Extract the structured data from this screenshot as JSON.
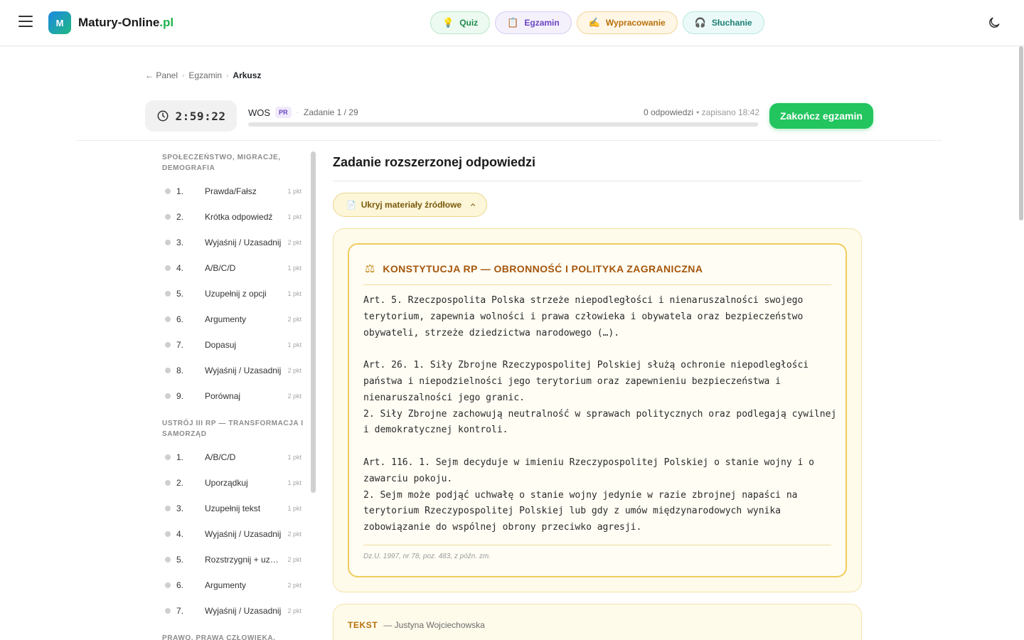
{
  "header": {
    "logo_letter": "M",
    "brand_name": "Matury-Online",
    "brand_tld": ".pl",
    "nav": [
      {
        "label": "Quiz",
        "icon": "lightbulb-icon",
        "glyph": "💡"
      },
      {
        "label": "Egzamin",
        "icon": "clipboard-icon",
        "glyph": "📋"
      },
      {
        "label": "Wypracowanie",
        "icon": "writing-hand-icon",
        "glyph": "✍️"
      },
      {
        "label": "Słuchanie",
        "icon": "headphones-icon",
        "glyph": "🎧"
      }
    ]
  },
  "breadcrumb": {
    "back": "← Panel",
    "middle": "Egzamin",
    "current": "Arkusz"
  },
  "exam": {
    "timer": "2:59:22",
    "subject": "WOS",
    "level_badge": "PR",
    "task_counter": "Zadanie 1 / 29",
    "answers": "0 odpowiedzi",
    "saved": "• zapisano 18:42",
    "progress_fraction": 0.0,
    "finish_label": "Zakończ egzamin"
  },
  "sidebar": {
    "sections": [
      {
        "title_line1": "SPOŁECZEŃSTWO, MIGRACJE,",
        "title_line2": "DEMOGRAFIA",
        "tasks": [
          {
            "num": "1.",
            "type": "Prawda/Fałsz",
            "pts": "1 pkt"
          },
          {
            "num": "2.",
            "type": "Krótka odpowiedź",
            "pts": "1 pkt"
          },
          {
            "num": "3.",
            "type": "Wyjaśnij / Uzasadnij",
            "pts": "2 pkt"
          },
          {
            "num": "4.",
            "type": "A/B/C/D",
            "pts": "1 pkt"
          },
          {
            "num": "5.",
            "type": "Uzupełnij z opcji",
            "pts": "1 pkt"
          },
          {
            "num": "6.",
            "type": "Argumenty",
            "pts": "2 pkt"
          },
          {
            "num": "7.",
            "type": "Dopasuj",
            "pts": "1 pkt"
          },
          {
            "num": "8.",
            "type": "Wyjaśnij / Uzasadnij",
            "pts": "2 pkt"
          },
          {
            "num": "9.",
            "type": "Porównaj",
            "pts": "2 pkt"
          }
        ]
      },
      {
        "title_line1": "USTRÓJ III RP — TRANSFORMACJA I",
        "title_line2": "SAMORZĄD",
        "tasks": [
          {
            "num": "1.",
            "type": "A/B/C/D",
            "pts": "1 pkt"
          },
          {
            "num": "2.",
            "type": "Uporządkuj",
            "pts": "1 pkt"
          },
          {
            "num": "3.",
            "type": "Uzupełnij tekst",
            "pts": "1 pkt"
          },
          {
            "num": "4.",
            "type": "Wyjaśnij / Uzasadnij",
            "pts": "2 pkt"
          },
          {
            "num": "5.",
            "type": "Rozstrzygnij + uza...",
            "pts": "2 pkt"
          },
          {
            "num": "6.",
            "type": "Argumenty",
            "pts": "2 pkt"
          },
          {
            "num": "7.",
            "type": "Wyjaśnij / Uzasadnij",
            "pts": "2 pkt"
          }
        ]
      },
      {
        "title_line1": "PRAWO, PRAWA CZŁOWIEKA,"
      }
    ]
  },
  "main": {
    "title": "Zadanie rozszerzonej odpowiedzi",
    "toggle_label": "Ukryj materiały źródłowe",
    "source": {
      "title": "KONSTYTUCJA RP — OBRONNOŚĆ I POLITYKA ZAGRANICZNA",
      "body": "Art. 5. Rzeczpospolita Polska strzeże niepodległości i nienaruszalności swojego\nterytorium, zapewnia wolności i prawa człowieka i obywatela oraz bezpieczeństwo\nobywateli, strzeże dziedzictwa narodowego (…).\n\nArt. 26. 1. Siły Zbrojne Rzeczypospolitej Polskiej służą ochronie niepodległości\npaństwa i niepodzielności jego terytorium oraz zapewnieniu bezpieczeństwa i\nnienaruszalności jego granic.\n2. Siły Zbrojne zachowują neutralność w sprawach politycznych oraz podlegają cywilnej\ni demokratycznej kontroli.\n\nArt. 116. 1. Sejm decyduje w imieniu Rzeczypospolitej Polskiej o stanie wojny i o\nzawarciu pokoju.\n2. Sejm może podjąć uchwałę o stanie wojny jedynie w razie zbrojnej napaści na\nterytorium Rzeczypospolitej Polskiej lub gdy z umów międzynarodowych wynika\nzobowiązanie do wspólnej obrony przeciwko agresji.",
      "footnote": "Dz.U. 1997, nr 78, poz. 483, z późn. zm."
    },
    "text_card": {
      "tag": "TEKST",
      "author": "— Justyna Wojciechowska"
    }
  }
}
